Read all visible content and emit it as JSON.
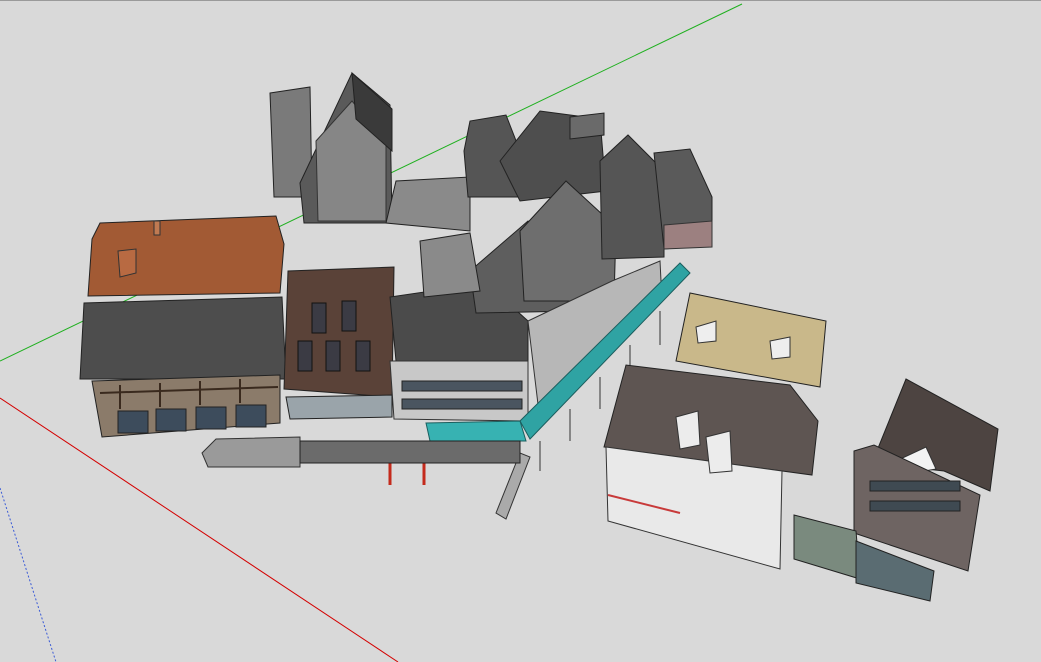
{
  "viewport": {
    "background": "#d9d9d9",
    "axes": {
      "x_color": "#d40000",
      "y_color": "#1fb01f",
      "z_color": "#3b5bd6"
    },
    "model": "urban-building-block-3d"
  }
}
